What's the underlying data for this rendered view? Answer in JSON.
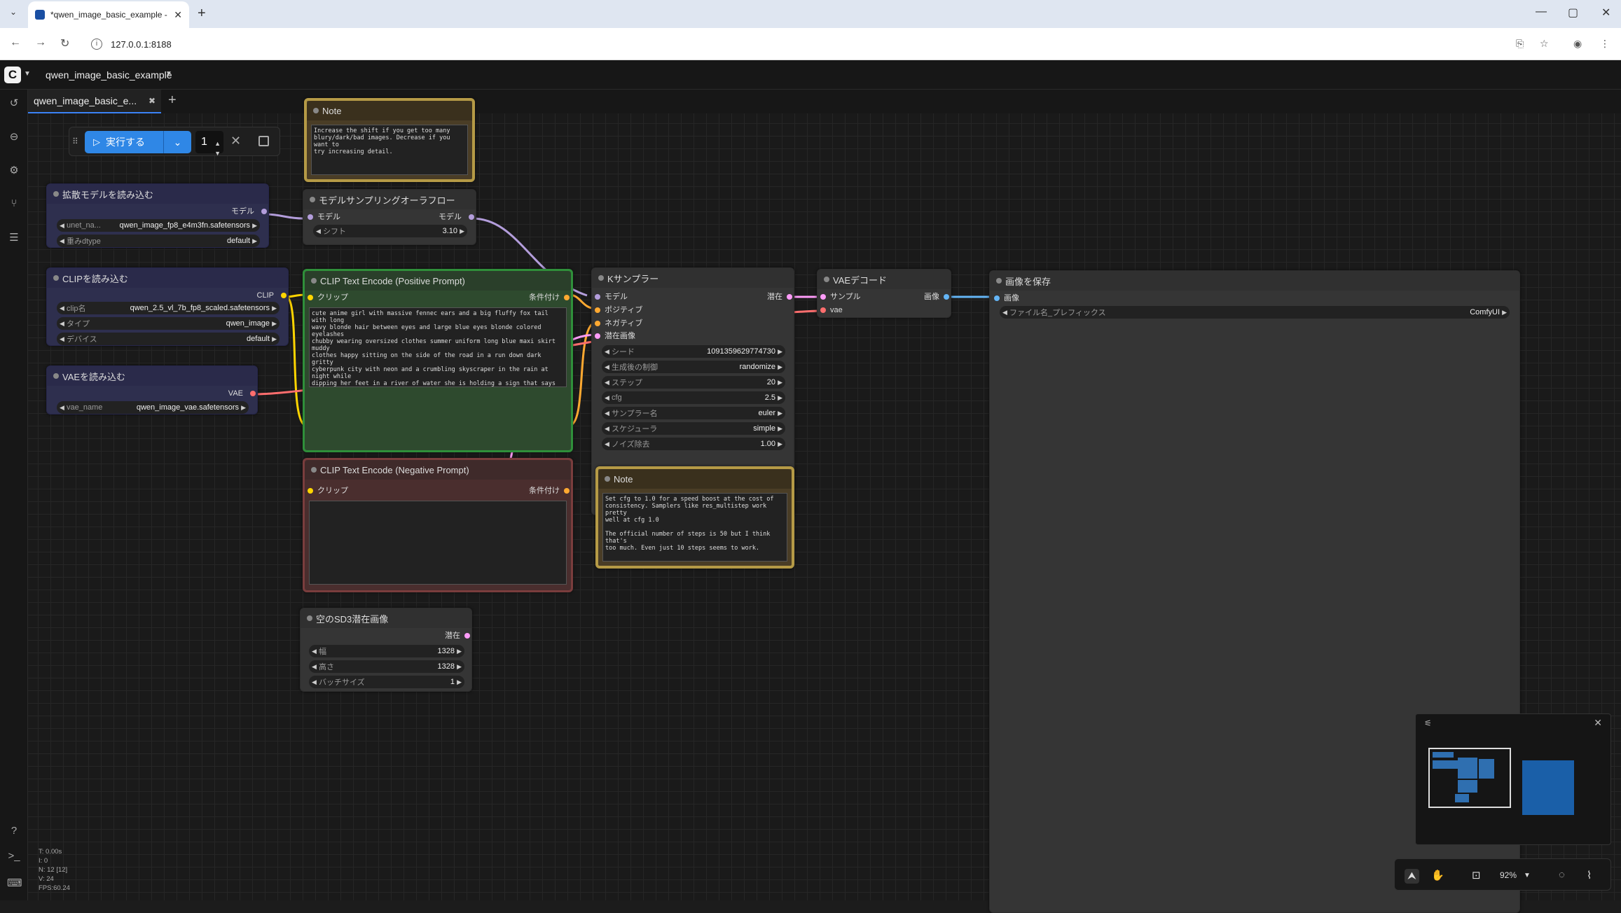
{
  "browser": {
    "tab_title": "*qwen_image_basic_example -",
    "url": "127.0.0.1:8188"
  },
  "app": {
    "workflow_title": "qwen_image_basic_example",
    "tab_label": "qwen_image_basic_e...",
    "add_tab": "+"
  },
  "runbar": {
    "run_label": "実行する",
    "batch_count": "1"
  },
  "nodes": {
    "note1": {
      "title": "Note",
      "text": "Increase the shift if you get too many\nblury/dark/bad images. Decrease if you want to\ntry increasing detail."
    },
    "unet": {
      "title": "拡散モデルを読み込む",
      "out": "モデル",
      "w1_label": "unet_na...",
      "w1_value": "qwen_image_fp8_e4m3fn.safetensors",
      "w2_label": "重みdtype",
      "w2_value": "default"
    },
    "aura": {
      "title": "モデルサンプリングオーラフロー",
      "in": "モデル",
      "out": "モデル",
      "w1_label": "シフト",
      "w1_value": "3.10"
    },
    "clip": {
      "title": "CLIPを読み込む",
      "out": "CLIP",
      "w1_label": "clip名",
      "w1_value": "qwen_2.5_vl_7b_fp8_scaled.safetensors",
      "w2_label": "タイプ",
      "w2_value": "qwen_image",
      "w3_label": "デバイス",
      "w3_value": "default"
    },
    "vae": {
      "title": "VAEを読み込む",
      "out": "VAE",
      "w1_label": "vae_name",
      "w1_value": "qwen_image_vae.safetensors"
    },
    "pos": {
      "title": "CLIP Text Encode (Positive Prompt)",
      "in": "クリップ",
      "out": "条件付け",
      "text": "cute anime girl with massive fennec ears and a big fluffy fox tail with long\nwavy blonde hair between eyes and large blue eyes blonde colored eyelashes\nchubby wearing oversized clothes summer uniform long blue maxi skirt muddy\nclothes happy sitting on the side of the road in a run down dark gritty\ncyberpunk city with neon and a crumbling skyscraper in the rain at night while\ndipping her feet in a river of water she is holding a sign that says \"ComfyUI\nis the best\" written in cursive"
    },
    "neg": {
      "title": "CLIP Text Encode (Negative Prompt)",
      "in": "クリップ",
      "out": "条件付け"
    },
    "latent": {
      "title": "空のSD3潜在画像",
      "out": "潜在",
      "w1_label": "幅",
      "w1_value": "1328",
      "w2_label": "高さ",
      "w2_value": "1328",
      "w3_label": "バッチサイズ",
      "w3_value": "1"
    },
    "ksampler": {
      "title": "Kサンプラー",
      "in1": "モデル",
      "in2": "ポジティブ",
      "in3": "ネガティブ",
      "in4": "潜在画像",
      "out": "潜在",
      "w1_label": "シード",
      "w1_value": "1091359629774730",
      "w2_label": "生成後の制御",
      "w2_value": "randomize",
      "w3_label": "ステップ",
      "w3_value": "20",
      "w4_label": "cfg",
      "w4_value": "2.5",
      "w5_label": "サンプラー名",
      "w5_value": "euler",
      "w6_label": "スケジューラ",
      "w6_value": "simple",
      "w7_label": "ノイズ除去",
      "w7_value": "1.00"
    },
    "note2": {
      "title": "Note",
      "text": "Set cfg to 1.0 for a speed boost at the cost of\nconsistency. Samplers like res_multistep work pretty\nwell at cfg 1.0\n\nThe official number of steps is 50 but I think that's\ntoo much. Even just 10 steps seems to work."
    },
    "vaedec": {
      "title": "VAEデコード",
      "in1": "サンプル",
      "in2": "vae",
      "out": "画像"
    },
    "save": {
      "title": "画像を保存",
      "in": "画像",
      "w1_label": "ファイル名_プレフィックス",
      "w1_value": "ComfyUI"
    }
  },
  "stats": {
    "t": "T: 0.00s",
    "i": "I: 0",
    "n": "N: 12 [12]",
    "v": "V: 24",
    "fps": "FPS:60.24"
  },
  "canvas": {
    "zoom": "92%"
  },
  "colors": {
    "accent": "#2f87e6",
    "clip_link": "#ffd500",
    "model_link": "#b39ddb",
    "cond_link": "#ffa931",
    "latent_link": "#ff9cf9",
    "vae_link": "#ff6e6e",
    "image_link": "#64b5f6"
  }
}
